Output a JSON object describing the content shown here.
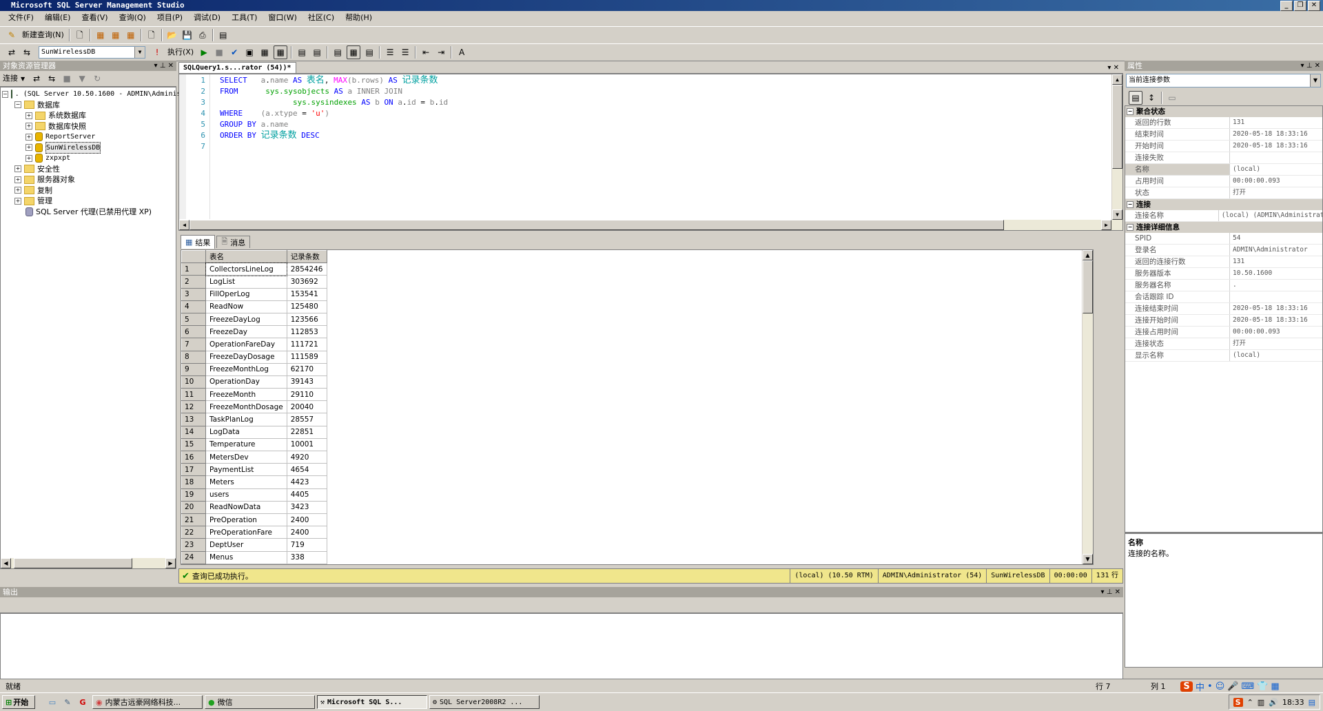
{
  "window": {
    "title": "Microsoft SQL Server Management Studio"
  },
  "menu": [
    "文件(F)",
    "编辑(E)",
    "查看(V)",
    "查询(Q)",
    "项目(P)",
    "调试(D)",
    "工具(T)",
    "窗口(W)",
    "社区(C)",
    "帮助(H)"
  ],
  "toolbar": {
    "new_query": "新建查询(N)",
    "database_selected": "SunWirelessDB",
    "execute": "执行(X)"
  },
  "object_explorer": {
    "title": "对象资源管理器",
    "connect": "连接",
    "server": ". (SQL Server 10.50.1600 - ADMIN\\Administrator)",
    "databases": "数据库",
    "db_children": [
      "系统数据库",
      "数据库快照",
      "ReportServer",
      "SunWirelessDB",
      "zxpxpt"
    ],
    "other_nodes": [
      "安全性",
      "服务器对象",
      "复制",
      "管理"
    ],
    "agent": "SQL Server 代理(已禁用代理 XP)"
  },
  "editor": {
    "tab": "SQLQuery1.s...rator (54))*",
    "lines": [
      "1",
      "2",
      "3",
      "4",
      "5",
      "6",
      "7"
    ]
  },
  "results": {
    "tab_results": "结果",
    "tab_messages": "消息",
    "columns": [
      "表名",
      "记录条数"
    ],
    "rows": [
      [
        "1",
        "CollectorsLineLog",
        "2854246"
      ],
      [
        "2",
        "LogList",
        "303692"
      ],
      [
        "3",
        "FillOperLog",
        "153541"
      ],
      [
        "4",
        "ReadNow",
        "125480"
      ],
      [
        "5",
        "FreezeDayLog",
        "123566"
      ],
      [
        "6",
        "FreezeDay",
        "112853"
      ],
      [
        "7",
        "OperationFareDay",
        "111721"
      ],
      [
        "8",
        "FreezeDayDosage",
        "111589"
      ],
      [
        "9",
        "FreezeMonthLog",
        "62170"
      ],
      [
        "10",
        "OperationDay",
        "39143"
      ],
      [
        "11",
        "FreezeMonth",
        "29110"
      ],
      [
        "12",
        "FreezeMonthDosage",
        "20040"
      ],
      [
        "13",
        "TaskPlanLog",
        "28557"
      ],
      [
        "14",
        "LogData",
        "22851"
      ],
      [
        "15",
        "Temperature",
        "10001"
      ],
      [
        "16",
        "MetersDev",
        "4920"
      ],
      [
        "17",
        "PaymentList",
        "4654"
      ],
      [
        "18",
        "Meters",
        "4423"
      ],
      [
        "19",
        "users",
        "4405"
      ],
      [
        "20",
        "ReadNowData",
        "3423"
      ],
      [
        "21",
        "PreOperation",
        "2400"
      ],
      [
        "22",
        "PreOperationFare",
        "2400"
      ],
      [
        "23",
        "DeptUser",
        "719"
      ],
      [
        "24",
        "Menus",
        "338"
      ]
    ]
  },
  "query_status": {
    "message": "查询已成功执行。",
    "server": "(local) (10.50 RTM)",
    "user": "ADMIN\\Administrator (54)",
    "db": "SunWirelessDB",
    "time": "00:00:00",
    "rows": "131 行"
  },
  "output": {
    "title": "输出"
  },
  "properties": {
    "title": "属性",
    "selector": "当前连接参数",
    "categories": [
      {
        "name": "聚合状态",
        "items": [
          [
            "返回的行数",
            "131"
          ],
          [
            "结束时间",
            "2020-05-18 18:33:16"
          ],
          [
            "开始时间",
            "2020-05-18 18:33:16"
          ],
          [
            "连接失败",
            ""
          ],
          [
            "名称",
            "(local)"
          ],
          [
            "占用时间",
            "00:00:00.093"
          ],
          [
            "状态",
            "打开"
          ]
        ]
      },
      {
        "name": "连接",
        "items": [
          [
            "连接名称",
            "(local) (ADMIN\\Administrator)"
          ]
        ]
      },
      {
        "name": "连接详细信息",
        "items": [
          [
            "SPID",
            "54"
          ],
          [
            "登录名",
            "ADMIN\\Administrator"
          ],
          [
            "返回的连接行数",
            "131"
          ],
          [
            "服务器版本",
            "10.50.1600"
          ],
          [
            "服务器名称",
            "."
          ],
          [
            "会话跟踪 ID",
            ""
          ],
          [
            "连接结束时间",
            "2020-05-18 18:33:16"
          ],
          [
            "连接开始时间",
            "2020-05-18 18:33:16"
          ],
          [
            "连接占用时间",
            "00:00:00.093"
          ],
          [
            "连接状态",
            "打开"
          ],
          [
            "显示名称",
            "(local)"
          ]
        ]
      }
    ],
    "desc_title": "名称",
    "desc_text": "连接的名称。"
  },
  "statusbar": {
    "ready": "就绪",
    "line": "行 7",
    "col": "列 1"
  },
  "taskbar": {
    "start": "开始",
    "items": [
      "内蒙古远豪网络科技...",
      "微信",
      "Microsoft SQL S...",
      "SQL Server2008R2 ..."
    ],
    "clock": "18:33"
  }
}
